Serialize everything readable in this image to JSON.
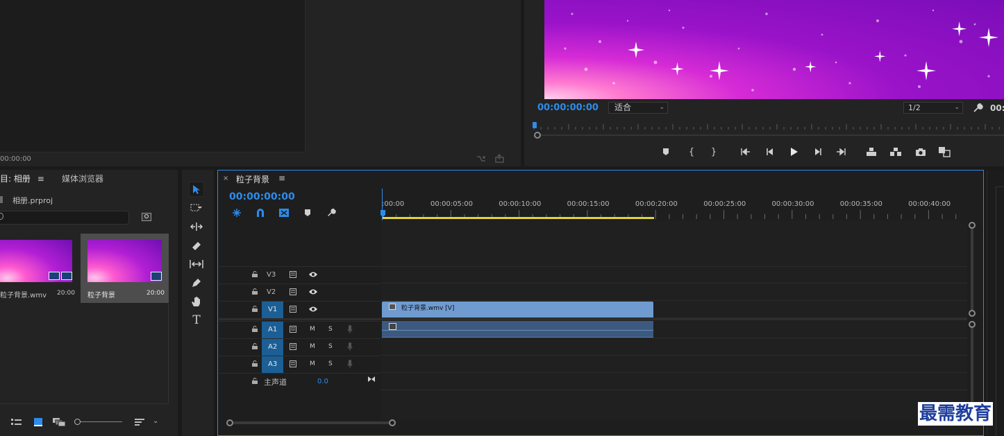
{
  "source_monitor": {
    "timecode": "00:00:00"
  },
  "program_monitor": {
    "timecode": "00:00:00:00",
    "zoom_select": "适合",
    "resolution_select": "1/2",
    "timecode_right": "00:"
  },
  "project_panel": {
    "tabs": [
      {
        "label": "目: 相册"
      },
      {
        "label": "媒体浏览器"
      }
    ],
    "project_file": "相册.prproj",
    "search_placeholder": "",
    "items": [
      {
        "name": "粒子背景.wmv",
        "duration": "20:00"
      },
      {
        "name": "粒子背景",
        "duration": "20:00"
      }
    ]
  },
  "timeline": {
    "tab_title": "粒子背景",
    "timecode": "00:00:00:00",
    "ruler_labels": [
      ":00:00",
      "00:00:05:00",
      "00:00:10:00",
      "00:00:15:00",
      "00:00:20:00",
      "00:00:25:00",
      "00:00:30:00",
      "00:00:35:00",
      "00:00:40:00"
    ],
    "video_tracks": [
      {
        "name": "V3",
        "target": false
      },
      {
        "name": "V2",
        "target": false
      },
      {
        "name": "V1",
        "target": true
      }
    ],
    "audio_tracks": [
      {
        "name": "A1",
        "mute": "M",
        "solo": "S"
      },
      {
        "name": "A2",
        "mute": "M",
        "solo": "S"
      },
      {
        "name": "A3",
        "mute": "M",
        "solo": "S"
      }
    ],
    "master": {
      "label": "主声道",
      "value": "0.0"
    },
    "clip_video_label": "粒子背景.wmv [V]"
  },
  "watermark": "最需教育",
  "colors": {
    "accent": "#2d8ceb",
    "clip_video": "#6f9bd1",
    "clip_audio": "#3c5a7f",
    "work_area": "#e2d43a",
    "track_target": "#1b5f96"
  }
}
